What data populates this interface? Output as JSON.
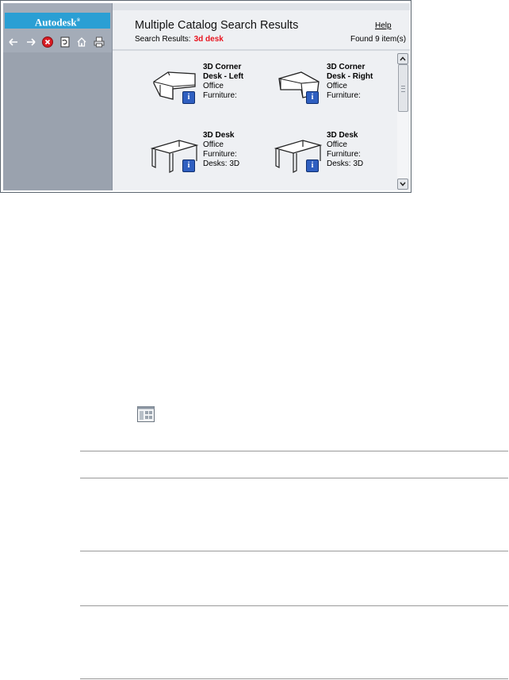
{
  "sidebar": {
    "brand": "Autodesk",
    "toolbar": [
      {
        "icon": "back-arrow-icon"
      },
      {
        "icon": "forward-arrow-icon"
      },
      {
        "icon": "stop-icon"
      },
      {
        "icon": "refresh-page-icon"
      },
      {
        "icon": "home-icon"
      },
      {
        "icon": "print-icon"
      }
    ]
  },
  "header": {
    "title": "Multiple Catalog Search Results",
    "help": "Help",
    "search_label": "Search Results:",
    "search_term": "3d desk",
    "found": "Found 9 item(s)"
  },
  "results": [
    {
      "name_lines": [
        "3D Corner",
        "Desk - Left"
      ],
      "cat_lines": [
        "Office",
        "Furniture:"
      ],
      "shape": "corner-left"
    },
    {
      "name_lines": [
        "3D Corner",
        "Desk - Right"
      ],
      "cat_lines": [
        "Office",
        "Furniture:"
      ],
      "shape": "corner-right"
    },
    {
      "name_lines": [
        "3D Desk"
      ],
      "cat_lines": [
        "Office",
        "Furniture:",
        "Desks: 3D"
      ],
      "shape": "desk"
    },
    {
      "name_lines": [
        "3D Desk"
      ],
      "cat_lines": [
        "Office",
        "Furniture:",
        "Desks: 3D"
      ],
      "shape": "desk"
    }
  ],
  "colors": {
    "brand_bar": "#2a9fd4",
    "search_term": "#e8141e",
    "info_button": "#2f5fc0"
  },
  "below": {
    "icon": "catalog-browser-icon"
  }
}
